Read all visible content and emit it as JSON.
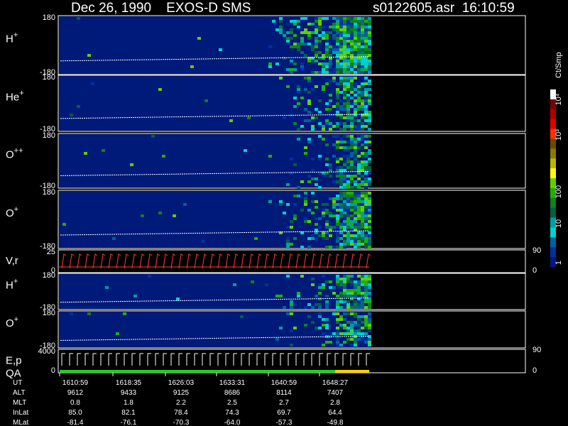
{
  "header": {
    "title": "Dec 26, 1990    EXOS-D SMS",
    "file": "s0122605.asr  16:10:59"
  },
  "panels": [
    {
      "label": "H",
      "sup": "+",
      "ymax": "180",
      "ymin": "-180",
      "kind": "spectro",
      "activity": 0.55,
      "seed": 1
    },
    {
      "label": "He",
      "sup": "+",
      "ymax": "180",
      "ymin": "-180",
      "kind": "spectro",
      "activity": 0.25,
      "seed": 2
    },
    {
      "label": "O",
      "sup": "++",
      "ymax": "180",
      "ymin": "-180",
      "kind": "spectro",
      "activity": 0.22,
      "seed": 3
    },
    {
      "label": "O",
      "sup": "+",
      "ymax": "180",
      "ymin": "-180",
      "kind": "spectro",
      "activity": 0.35,
      "seed": 4
    },
    {
      "label": "V,r",
      "sup": "",
      "ymax": "25",
      "ymin": "0",
      "kind": "velocity",
      "right_top": "90",
      "right_bottom": "0"
    },
    {
      "label": "H",
      "sup": "+",
      "ymax": "180",
      "ymin": "-180",
      "kind": "spectro",
      "activity": 0.3,
      "seed": 5
    },
    {
      "label": "O",
      "sup": "+",
      "ymax": "180",
      "ymin": "-180",
      "kind": "spectro",
      "activity": 0.2,
      "seed": 6
    },
    {
      "label": "E,p",
      "label2": "QA",
      "sup": "",
      "ymax": "4000",
      "ymin": "0",
      "kind": "energy",
      "right_top": "90",
      "right_bottom": "0"
    }
  ],
  "colorbar": {
    "title": "Ct/Smp",
    "tick_labels": [
      "10⁴",
      "10³",
      "100",
      "10",
      "1"
    ],
    "colors": [
      "#ffffff",
      "#7a0000",
      "#b00000",
      "#e00000",
      "#ff3000",
      "#6a4a00",
      "#8a7a00",
      "#b8b800",
      "#ffff00",
      "#60d000",
      "#20b000",
      "#108020",
      "#006040",
      "#00a0a0",
      "#00d0d0",
      "#0060a0",
      "#0030a0",
      "#001880"
    ]
  },
  "chart_data": {
    "type": "heatmap",
    "title": "Dec 26, 1990    EXOS-D SMS",
    "x_axis_rows": [
      {
        "name": "UT",
        "values": [
          "1610:59",
          "1618:35",
          "1626:03",
          "1633:31",
          "1640:59",
          "1648:27"
        ]
      },
      {
        "name": "ALT",
        "values": [
          "9612",
          "9433",
          "9125",
          "8686",
          "8114",
          "7407"
        ]
      },
      {
        "name": "MLT",
        "values": [
          "0.8",
          "1.8",
          "2.2",
          "2.5",
          "2.7",
          "2.8"
        ]
      },
      {
        "name": "InLat",
        "values": [
          "85.0",
          "82.1",
          "78.4",
          "74.3",
          "69.7",
          "64.4"
        ]
      },
      {
        "name": "MLat",
        "values": [
          "-81.4",
          "-76.1",
          "-70.3",
          "-64.0",
          "-57.3",
          "-49.8"
        ]
      }
    ],
    "colorbar_range": [
      "1",
      "10⁴"
    ],
    "colorbar_label": "Ct/Smp"
  }
}
